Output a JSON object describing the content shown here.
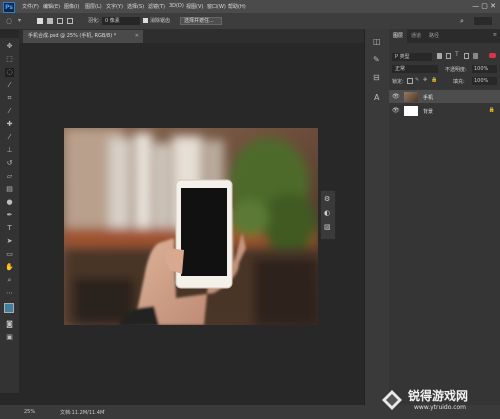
{
  "app": {
    "logo": "Ps"
  },
  "menu": [
    "文件(F)",
    "编辑(E)",
    "图像(I)",
    "图层(L)",
    "文字(Y)",
    "选择(S)",
    "滤镜(T)",
    "3D(D)",
    "视图(V)",
    "窗口(W)",
    "帮助(H)"
  ],
  "options": {
    "feather_label": "羽化:",
    "feather_value": "0 像素",
    "antialias_label": "消除锯齿",
    "select_mask_button": "选择并遮住..."
  },
  "document": {
    "tab_title": "手机合成.psd @ 25% (手机, RGB/8) *"
  },
  "panel": {
    "tabs": [
      "图层",
      "通道",
      "路径"
    ],
    "kind_filter": "P 类型",
    "blend_mode": "正常",
    "opacity_label": "不透明度:",
    "opacity_value": "100%",
    "lock_label": "锁定:",
    "fill_label": "填充:",
    "fill_value": "100%",
    "layers": [
      {
        "name": "手机",
        "selected": true
      },
      {
        "name": "背景",
        "selected": false
      }
    ]
  },
  "status": {
    "zoom": "25%",
    "doc_info": "文档:11.2M/11.4M"
  },
  "watermark": {
    "brand": "锐得游戏网",
    "url": "www.ytruido.com"
  },
  "colors": {
    "accent": "#2f7fd2",
    "selected_layer": "#4d4d4d",
    "panel_bg": "#353535"
  }
}
